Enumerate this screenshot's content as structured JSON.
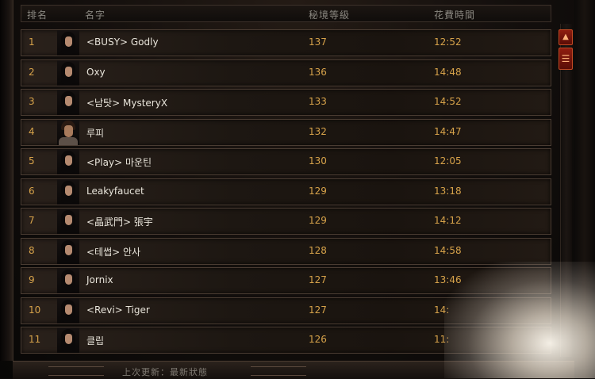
{
  "table": {
    "headers": {
      "rank": "排名",
      "name": "名字",
      "level": "秘境等級",
      "time": "花費時間"
    },
    "rows": [
      {
        "rank": "1",
        "name": "<BUSY> Godly",
        "level": "137",
        "time": "12:52",
        "portrait": "female-portrait-icon"
      },
      {
        "rank": "2",
        "name": "Oxy",
        "level": "136",
        "time": "14:48",
        "portrait": "female-portrait-icon"
      },
      {
        "rank": "3",
        "name": "<남탓> MysteryX",
        "level": "133",
        "time": "14:52",
        "portrait": "female-portrait-icon"
      },
      {
        "rank": "4",
        "name": "루피",
        "level": "132",
        "time": "14:47",
        "portrait": "male-portrait-icon"
      },
      {
        "rank": "5",
        "name": "<Play> 마운틴",
        "level": "130",
        "time": "12:05",
        "portrait": "female-portrait-icon"
      },
      {
        "rank": "6",
        "name": "Leakyfaucet",
        "level": "129",
        "time": "13:18",
        "portrait": "female-portrait-icon"
      },
      {
        "rank": "7",
        "name": "<晶武門> 張宇",
        "level": "129",
        "time": "14:12",
        "portrait": "female-portrait-icon"
      },
      {
        "rank": "8",
        "name": "<테썹> 안사",
        "level": "128",
        "time": "14:58",
        "portrait": "female-portrait-icon"
      },
      {
        "rank": "9",
        "name": "Jornix",
        "level": "127",
        "time": "13:46",
        "portrait": "female-portrait-icon"
      },
      {
        "rank": "10",
        "name": "<Revi> Tiger",
        "level": "127",
        "time": "14:",
        "portrait": "female-portrait-icon"
      },
      {
        "rank": "11",
        "name": "클립",
        "level": "126",
        "time": "11:",
        "portrait": "female-portrait-icon"
      }
    ]
  },
  "scrollbar": {
    "up_glyph": "▲",
    "handle_glyph": "☰"
  },
  "footer": {
    "status": "上次更新：最新狀態"
  },
  "colors": {
    "accent_gold": "#d6a24a",
    "name_text": "#e8e4da",
    "header_text": "#8a8780",
    "button_red": "#8f1d10"
  }
}
